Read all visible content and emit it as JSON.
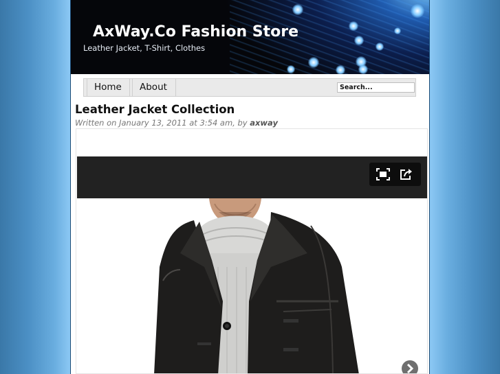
{
  "site": {
    "title": "AxWay.Co Fashion Store",
    "description": "Leather Jacket, T-Shirt, Clothes"
  },
  "nav": {
    "items": [
      {
        "label": "Home"
      },
      {
        "label": "About"
      }
    ],
    "search_value": "Search..."
  },
  "post": {
    "title": "Leather Jacket Collection",
    "meta_prefix": "Written on January 13, 2011 at 3:54 am, by ",
    "author": "axway"
  },
  "icons": {
    "fullscreen": "fullscreen-icon",
    "share": "share-icon",
    "next": "chevron-right-icon"
  },
  "colors": {
    "header_bg": "#05060a",
    "accent_blue": "#3a8ff0",
    "video_bar": "#222222"
  }
}
